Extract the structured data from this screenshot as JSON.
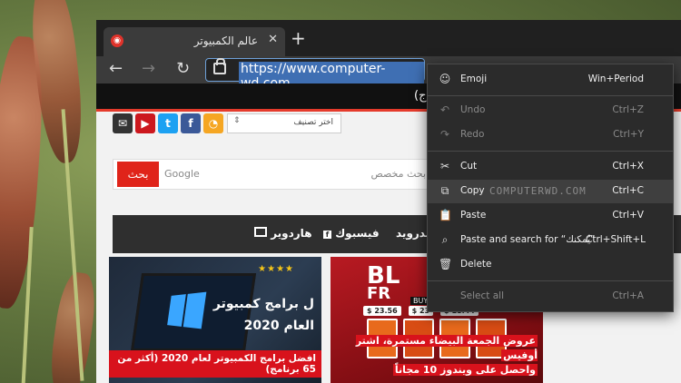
{
  "browser": {
    "tab_title": "عالم الكمبيوتر",
    "tab_close": "✕",
    "new_tab": "+",
    "url": "https://www.computer-wd.com",
    "site_bar_text": "(ج"
  },
  "page": {
    "category_select": "اختر تصنيف",
    "search_button": "بحث",
    "search_google": "Google",
    "search_placeholder": "بحث مخصص",
    "nav": [
      "الدرويد",
      "فيسبوك",
      "هاردوير"
    ],
    "cards": [
      {
        "overlay_lines": [
          "ل برامج كمبيوتر",
          "العام 2020"
        ],
        "stars": "★★★★",
        "caption": "افضل برامج الكمبيوتر لعام 2020 (أكثر من 65 برنامج)"
      },
      {
        "big_text": "BL",
        "big_text2": "FR",
        "buy_text": "BUY",
        "prices": [
          "$ 23.56",
          "$ 23",
          "$ 18.44"
        ],
        "caption_line1": "عروض الجمعة البيضاء مستمرة، اشتر أوفيس",
        "caption_line2": "واحصل على ويندوز 10 مجاناً"
      }
    ]
  },
  "context_menu": {
    "watermark": "COMPUTERWD.COM",
    "items": [
      {
        "label": "Emoji",
        "shortcut": "Win+Period"
      },
      {
        "label": "Undo",
        "shortcut": "Ctrl+Z"
      },
      {
        "label": "Redo",
        "shortcut": "Ctrl+Y"
      },
      {
        "label": "Cut",
        "shortcut": "Ctrl+X"
      },
      {
        "label": "Copy",
        "shortcut": "Ctrl+C"
      },
      {
        "label": "Paste",
        "shortcut": "Ctrl+V"
      },
      {
        "label": "Paste and search for “يُمكنك”",
        "shortcut": "Ctrl+Shift+L"
      },
      {
        "label": "Delete",
        "shortcut": ""
      },
      {
        "label": "Select all",
        "shortcut": "Ctrl+A"
      }
    ]
  }
}
